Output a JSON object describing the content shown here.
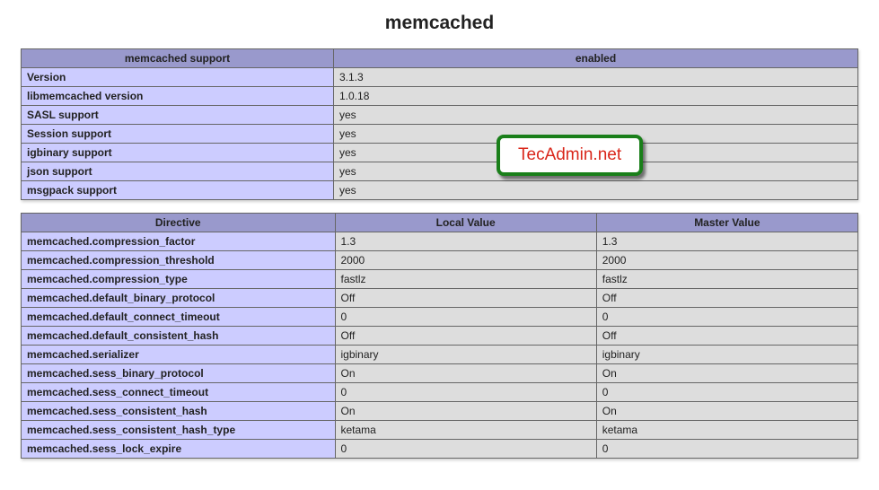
{
  "title": "memcached",
  "table1": {
    "header_left": "memcached support",
    "header_right": "enabled",
    "rows": [
      {
        "k": "Version",
        "v": "3.1.3"
      },
      {
        "k": "libmemcached version",
        "v": "1.0.18"
      },
      {
        "k": "SASL support",
        "v": "yes"
      },
      {
        "k": "Session support",
        "v": "yes"
      },
      {
        "k": "igbinary support",
        "v": "yes"
      },
      {
        "k": "json support",
        "v": "yes"
      },
      {
        "k": "msgpack support",
        "v": "yes"
      }
    ]
  },
  "table2": {
    "header_directive": "Directive",
    "header_local": "Local Value",
    "header_master": "Master Value",
    "rows": [
      {
        "d": "memcached.compression_factor",
        "l": "1.3",
        "m": "1.3"
      },
      {
        "d": "memcached.compression_threshold",
        "l": "2000",
        "m": "2000"
      },
      {
        "d": "memcached.compression_type",
        "l": "fastlz",
        "m": "fastlz"
      },
      {
        "d": "memcached.default_binary_protocol",
        "l": "Off",
        "m": "Off"
      },
      {
        "d": "memcached.default_connect_timeout",
        "l": "0",
        "m": "0"
      },
      {
        "d": "memcached.default_consistent_hash",
        "l": "Off",
        "m": "Off"
      },
      {
        "d": "memcached.serializer",
        "l": "igbinary",
        "m": "igbinary"
      },
      {
        "d": "memcached.sess_binary_protocol",
        "l": "On",
        "m": "On"
      },
      {
        "d": "memcached.sess_connect_timeout",
        "l": "0",
        "m": "0"
      },
      {
        "d": "memcached.sess_consistent_hash",
        "l": "On",
        "m": "On"
      },
      {
        "d": "memcached.sess_consistent_hash_type",
        "l": "ketama",
        "m": "ketama"
      },
      {
        "d": "memcached.sess_lock_expire",
        "l": "0",
        "m": "0"
      }
    ]
  },
  "watermark": "TecAdmin.net"
}
